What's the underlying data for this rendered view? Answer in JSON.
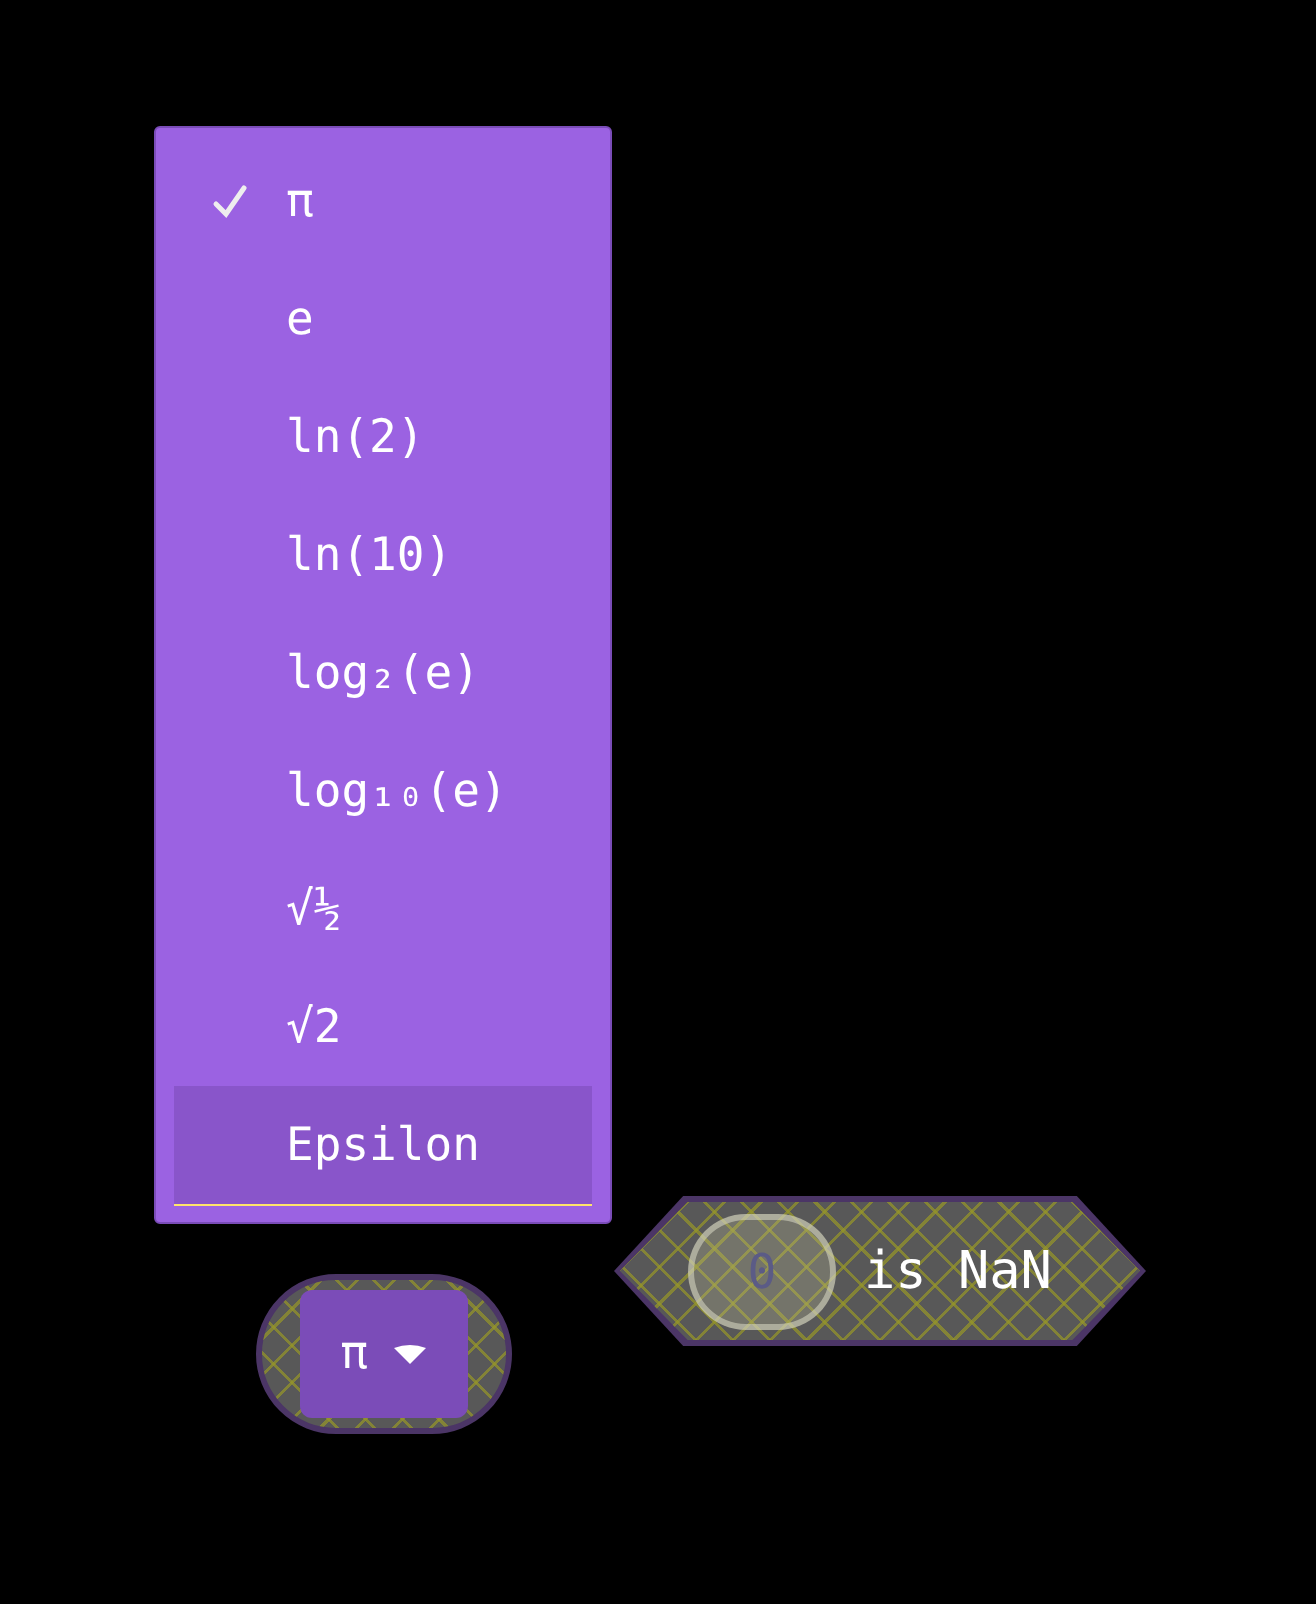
{
  "menu": {
    "items": [
      {
        "label": "π",
        "selected": true,
        "highlighted": false
      },
      {
        "label": "e",
        "selected": false,
        "highlighted": false
      },
      {
        "label": "ln(2)",
        "selected": false,
        "highlighted": false
      },
      {
        "label": "ln(10)",
        "selected": false,
        "highlighted": false
      },
      {
        "label": "log₂(e)",
        "selected": false,
        "highlighted": false
      },
      {
        "label": "log₁₀(e)",
        "selected": false,
        "highlighted": false
      },
      {
        "label": "√½",
        "selected": false,
        "highlighted": false
      },
      {
        "label": "√2",
        "selected": false,
        "highlighted": false
      },
      {
        "label": "Epsilon",
        "selected": false,
        "highlighted": true
      }
    ]
  },
  "constant_block": {
    "value": "π"
  },
  "nan_block": {
    "input": "0",
    "label": "is NaN"
  }
}
